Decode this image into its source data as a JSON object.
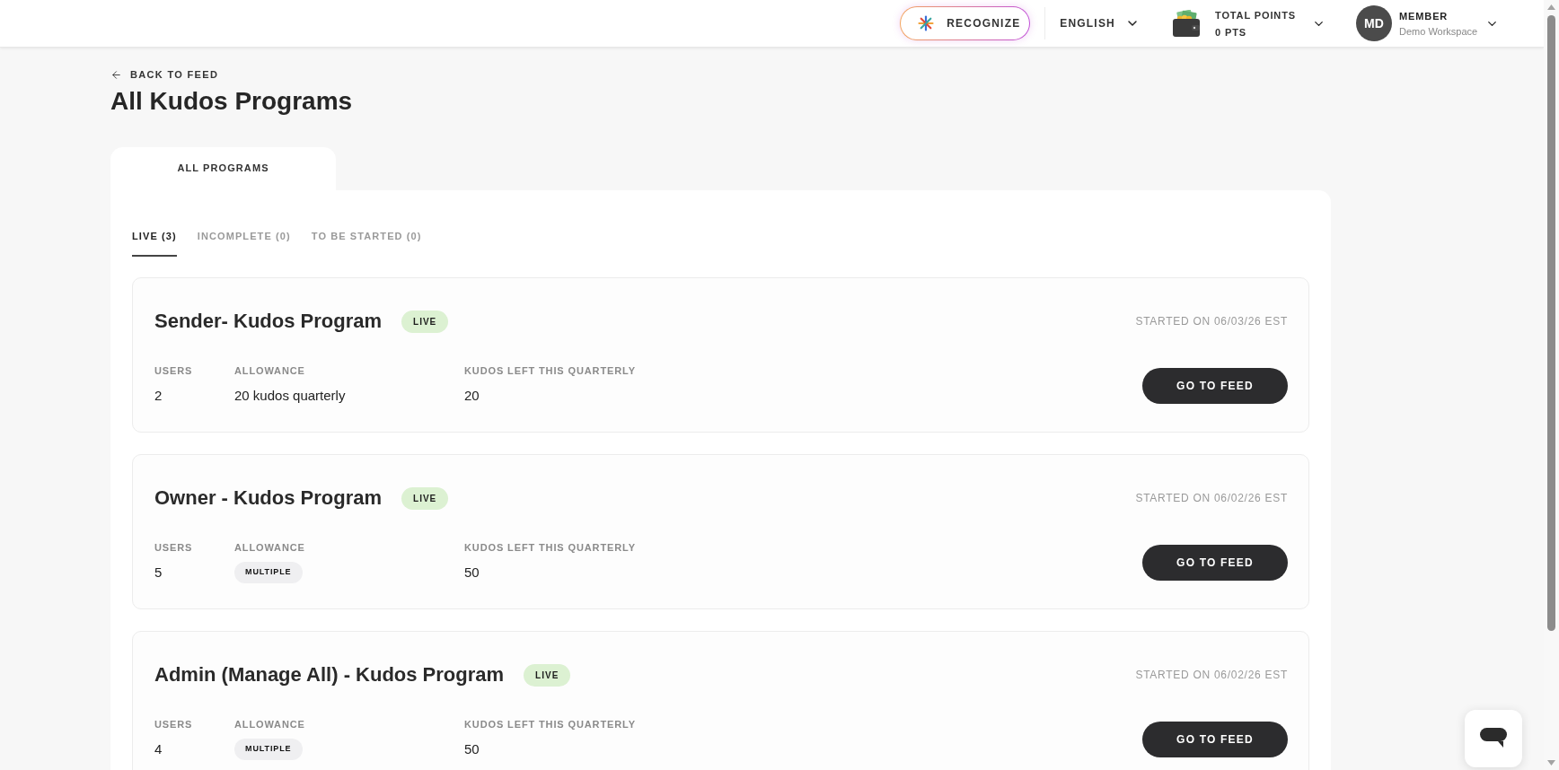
{
  "header": {
    "recognize_button": "RECOGNIZE",
    "language": "ENGLISH",
    "points": {
      "label": "TOTAL POINTS",
      "value": "0 PTS"
    },
    "user": {
      "initials": "MD",
      "role": "MEMBER",
      "workspace": "Demo Workspace"
    }
  },
  "back_link": "BACK TO FEED",
  "title": "All Kudos Programs",
  "tabs": [
    {
      "label": "ALL PROGRAMS",
      "selected": true
    }
  ],
  "filters": [
    {
      "label": "LIVE (3)",
      "selected": true
    },
    {
      "label": "INCOMPLETE (0)",
      "selected": false
    },
    {
      "label": "TO BE STARTED (0)",
      "selected": false
    }
  ],
  "programs": [
    {
      "name": "Sender- Kudos Program",
      "status": "LIVE",
      "started": "STARTED ON 06/03/26 EST",
      "fields": [
        {
          "label": "USERS",
          "value": "2",
          "kind": "text"
        },
        {
          "label": "ALLOWANCE",
          "value": "20 kudos quarterly",
          "kind": "text"
        },
        {
          "label": "KUDOS LEFT THIS QUARTERLY",
          "value": "20",
          "kind": "text"
        }
      ],
      "button": "GO TO FEED"
    },
    {
      "name": "Owner - Kudos Program",
      "status": "LIVE",
      "started": "STARTED ON 06/02/26 EST",
      "fields": [
        {
          "label": "USERS",
          "value": "5",
          "kind": "text"
        },
        {
          "label": "ALLOWANCE",
          "value": "MULTIPLE",
          "kind": "badge"
        },
        {
          "label": "KUDOS LEFT THIS QUARTERLY",
          "value": "50",
          "kind": "text"
        }
      ],
      "button": "GO TO FEED"
    },
    {
      "name": "Admin (Manage All) - Kudos Program",
      "status": "LIVE",
      "started": "STARTED ON 06/02/26 EST",
      "fields": [
        {
          "label": "USERS",
          "value": "4",
          "kind": "text"
        },
        {
          "label": "ALLOWANCE",
          "value": "MULTIPLE",
          "kind": "badge"
        },
        {
          "label": "KUDOS LEFT THIS QUARTERLY",
          "value": "50",
          "kind": "text"
        }
      ],
      "button": "GO TO FEED"
    }
  ]
}
